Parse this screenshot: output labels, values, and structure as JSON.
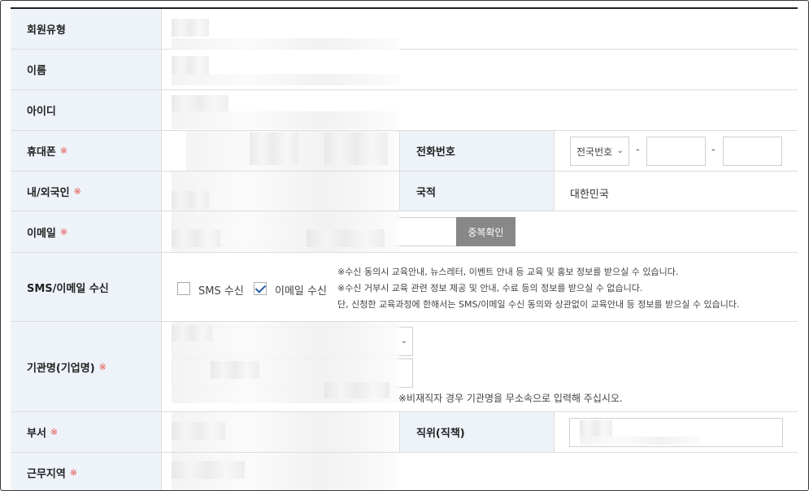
{
  "fields": {
    "member_type": {
      "label": "회원유형"
    },
    "name": {
      "label": "이름"
    },
    "user_id": {
      "label": "아이디"
    },
    "mobile": {
      "label": "휴대폰",
      "required_mark": "※"
    },
    "phone": {
      "label": "전화번호",
      "area_select": "전국번호",
      "separator": "-"
    },
    "nationality_type": {
      "label": "내/외국인",
      "required_mark": "※"
    },
    "country": {
      "label": "국적",
      "value": "대한민국"
    },
    "email": {
      "label": "이메일",
      "required_mark": "※",
      "check_button": "중복확인"
    },
    "consent": {
      "label": "SMS/이메일 수신",
      "sms_label": "SMS 수신",
      "sms_checked": false,
      "email_label": "이메일 수신",
      "email_checked": true,
      "notes": [
        "※수신 동의시 교육안내, 뉴스레터, 이벤트 안내 등 교육 및 홍보 정보를 받으실 수 있습니다.",
        "※수신 거부시 교육 관련 정보 제공 및 안내, 수료 등의 정보를 받으실 수 없습니다.",
        "단, 신청한 교육과정에 한해서는 SMS/이메일 수신 동의와 상관없이 교육안내 등 정보를 받으실 수 있습니다."
      ]
    },
    "organization": {
      "label": "기관명(기업명)",
      "required_mark": "※",
      "note": "※비재직자 경우 기관명을 무소속으로 입력해 주십시오."
    },
    "department": {
      "label": "부서",
      "required_mark": "※"
    },
    "position": {
      "label": "직위(직책)"
    },
    "work_region": {
      "label": "근무지역",
      "required_mark": "※"
    }
  }
}
